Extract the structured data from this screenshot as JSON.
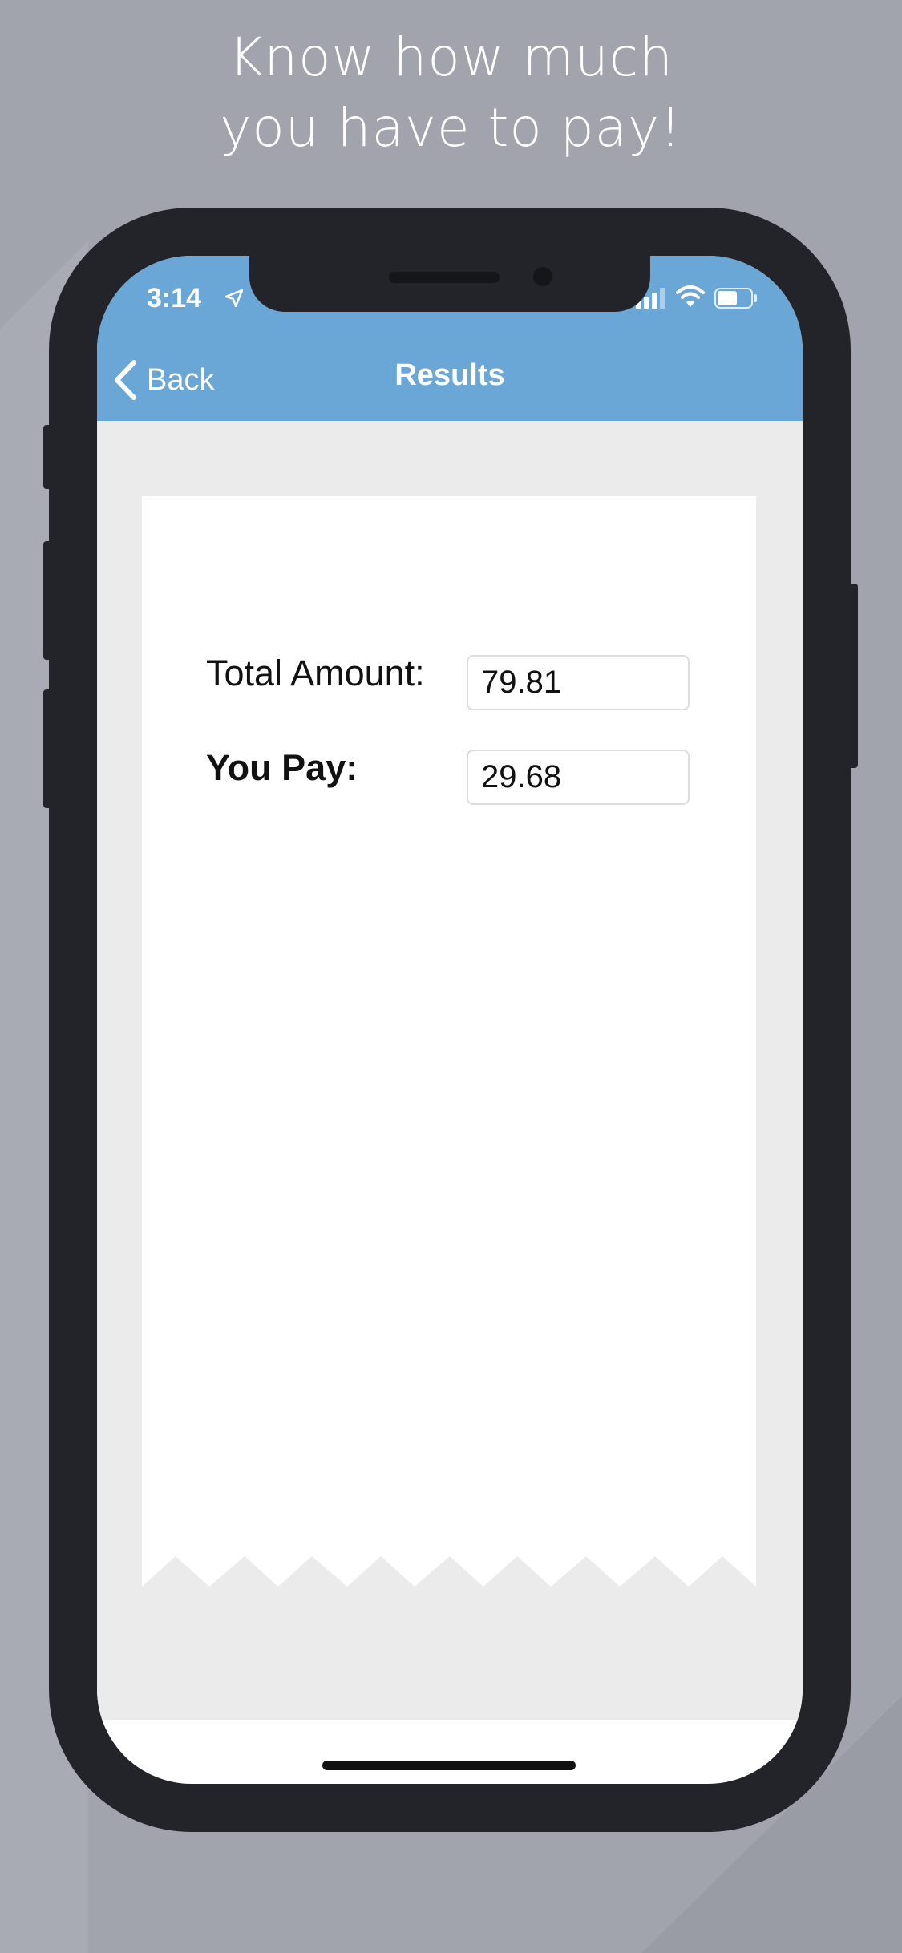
{
  "headline": {
    "line1": "Know how much",
    "line2": "you have to pay!"
  },
  "status_bar": {
    "time": "3:14",
    "icons": [
      "location-arrow-icon",
      "signal-icon",
      "wifi-icon",
      "battery-icon"
    ]
  },
  "nav": {
    "back_label": "Back",
    "title": "Results"
  },
  "results": {
    "total_label": "Total Amount:",
    "total_value": "79.81",
    "pay_label": "You Pay:",
    "pay_value": "29.68"
  },
  "colors": {
    "background": "#a1a3ad",
    "phone_body": "#232429",
    "nav_bar": "#6aa7d6",
    "content_bg": "#ebebeb",
    "receipt": "#ffffff"
  }
}
